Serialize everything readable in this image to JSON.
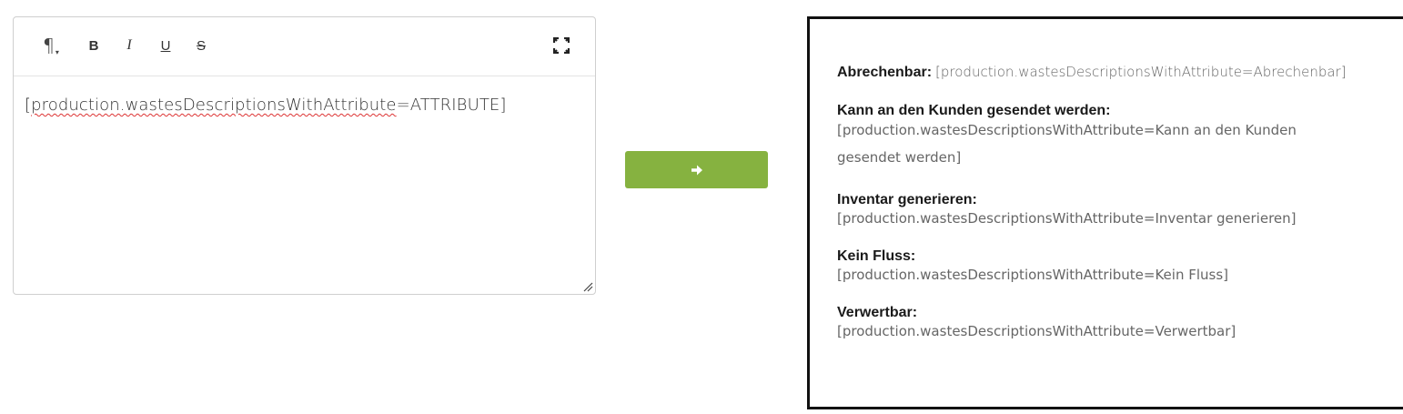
{
  "editor": {
    "toolbar": {
      "paragraph_icon": "¶",
      "bold_icon": "B",
      "italic_icon": "I",
      "underline_icon": "U",
      "strike_icon": "S"
    },
    "content": {
      "open_bracket": "[",
      "misspelled": "production.wastesDescriptionsWithAttribute",
      "rest": "=ATTRIBUTE]"
    }
  },
  "convert_button": {
    "icon": "arrow-right-icon",
    "color": "#86b240"
  },
  "preview": {
    "entries": [
      {
        "label": "Abrechenbar:",
        "value": "[production.wastesDescriptionsWithAttribute=Abrechenbar]"
      },
      {
        "label": "Kann an den Kunden gesendet werden:",
        "value": "[production.wastesDescriptionsWithAttribute=Kann an den Kunden gesendet werden]"
      },
      {
        "label": "Inventar generieren:",
        "value": "[production.wastesDescriptionsWithAttribute=Inventar generieren]"
      },
      {
        "label": "Kein Fluss:",
        "value": "[production.wastesDescriptionsWithAttribute=Kein Fluss]"
      },
      {
        "label": "Verwertbar:",
        "value": "[production.wastesDescriptionsWithAttribute=Verwertbar]"
      }
    ]
  }
}
